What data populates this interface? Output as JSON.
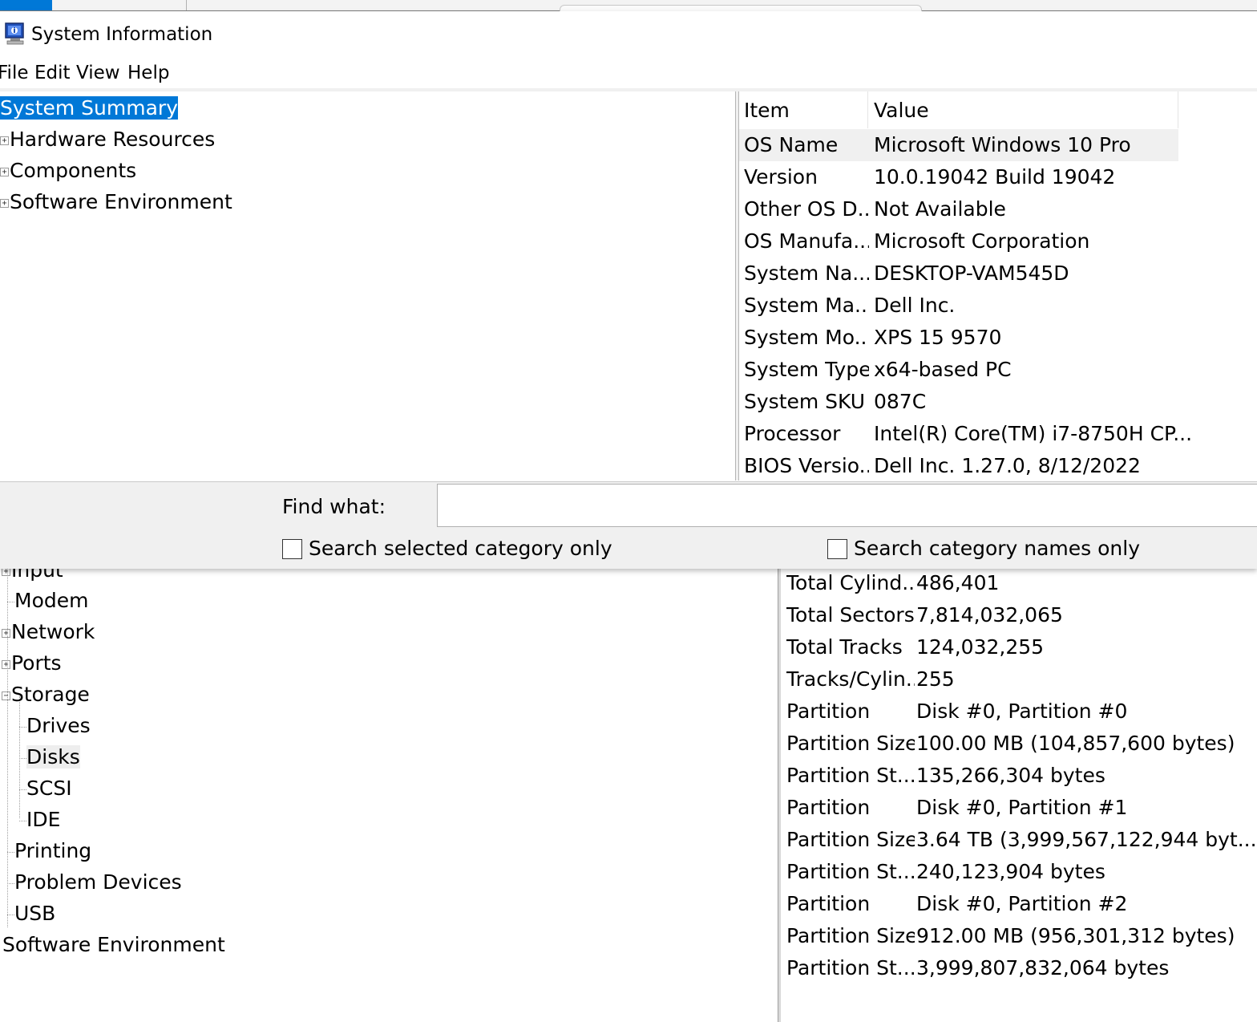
{
  "window": {
    "title": "System Information"
  },
  "menu": [
    "File",
    "Edit",
    "View",
    "Help"
  ],
  "tree": [
    {
      "label": "System Summary",
      "selected": true
    },
    {
      "label": "Hardware Resources",
      "expander": "+"
    },
    {
      "label": "Components",
      "expander": "+"
    },
    {
      "label": "Software Environment",
      "expander": "+"
    }
  ],
  "list": {
    "headers": {
      "item": "Item",
      "value": "Value"
    },
    "rows": [
      {
        "item": "OS Name",
        "value": "Microsoft Windows 10 Pro"
      },
      {
        "item": "Version",
        "value": "10.0.19042 Build 19042"
      },
      {
        "item": "Other OS D...",
        "value": "Not Available"
      },
      {
        "item": "OS Manufa...",
        "value": "Microsoft Corporation"
      },
      {
        "item": "System Na...",
        "value": "DESKTOP-VAM545D"
      },
      {
        "item": "System Ma...",
        "value": "Dell Inc."
      },
      {
        "item": "System Mo...",
        "value": "XPS 15 9570"
      },
      {
        "item": "System Type",
        "value": "x64-based PC"
      },
      {
        "item": "System SKU",
        "value": "087C"
      },
      {
        "item": "Processor",
        "value": "Intel(R) Core(TM) i7-8750H CP..."
      },
      {
        "item": "BIOS Versio...",
        "value": "Dell Inc. 1.27.0, 8/12/2022"
      }
    ]
  },
  "find": {
    "label": "Find what:",
    "value": "",
    "search_selected_label": "Search selected category only",
    "search_names_label": "Search category names only"
  },
  "back_tree": [
    {
      "label": "Input",
      "expander": "+"
    },
    {
      "label": "Modem"
    },
    {
      "label": "Network",
      "expander": "+"
    },
    {
      "label": "Ports",
      "expander": "+"
    },
    {
      "label": "Storage",
      "expander": "−"
    },
    {
      "label": "Drives"
    },
    {
      "label": "Disks",
      "selected": true
    },
    {
      "label": "SCSI"
    },
    {
      "label": "IDE"
    },
    {
      "label": "Printing"
    },
    {
      "label": "Problem Devices"
    },
    {
      "label": "USB"
    },
    {
      "label": "Software Environment"
    }
  ],
  "back_list": [
    {
      "item": "Total Cylind...",
      "value": "486,401"
    },
    {
      "item": "Total Sectors",
      "value": "7,814,032,065"
    },
    {
      "item": "Total Tracks",
      "value": "124,032,255"
    },
    {
      "item": "Tracks/Cylin...",
      "value": "255"
    },
    {
      "item": "Partition",
      "value": "Disk #0, Partition #0"
    },
    {
      "item": "Partition Size",
      "value": "100.00 MB (104,857,600 bytes)"
    },
    {
      "item": "Partition St...",
      "value": "135,266,304 bytes"
    },
    {
      "item": "Partition",
      "value": "Disk #0, Partition #1"
    },
    {
      "item": "Partition Size",
      "value": "3.64 TB (3,999,567,122,944 byt..."
    },
    {
      "item": "Partition St...",
      "value": "240,123,904 bytes"
    },
    {
      "item": "Partition",
      "value": "Disk #0, Partition #2"
    },
    {
      "item": "Partition Size",
      "value": "912.00 MB (956,301,312 bytes)"
    },
    {
      "item": "Partition St...",
      "value": "3,999,807,832,064 bytes"
    }
  ],
  "colors": {
    "selection": "#0078d7",
    "pane_bg": "#f0f0f0",
    "row_highlight": "#f0f0f0"
  }
}
